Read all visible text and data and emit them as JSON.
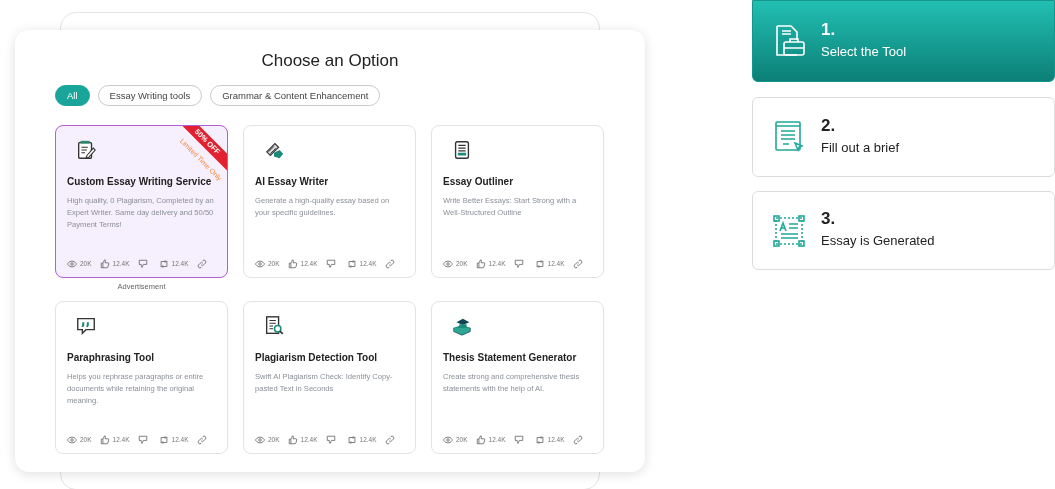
{
  "panel": {
    "title": "Choose an Option"
  },
  "filters": [
    {
      "label": "All",
      "selected": true
    },
    {
      "label": "Essay Writing tools",
      "selected": false
    },
    {
      "label": "Grammar & Content Enhancement",
      "selected": false
    }
  ],
  "tools": [
    {
      "title": "Custom Essay Writing Service",
      "description": "High quality, 0 Plagiarism, Completed by an Expert Writer. Same day delivery and 50/50 Payment Terms!",
      "featured": true,
      "ribbon": "50% OFF",
      "ribbon_note": "Limited Time Only",
      "caption": "Advertisement",
      "views": "20K",
      "likes": "12.4K",
      "shares": "12.4K"
    },
    {
      "title": "AI Essay Writer",
      "description": "Generate a high-quality essay based on your specific guidelines.",
      "featured": false,
      "views": "20K",
      "likes": "12.4K",
      "shares": "12.4K"
    },
    {
      "title": "Essay Outliner",
      "description": "Write Better Essays: Start Strong with a Well-Structured Outline",
      "featured": false,
      "views": "20K",
      "likes": "12.4K",
      "shares": "12.4K"
    },
    {
      "title": "Paraphrasing Tool",
      "description": "Helps you rephrase paragraphs or entire documents while retaining the original meaning.",
      "featured": false,
      "views": "20K",
      "likes": "12.4K",
      "shares": "12.4K"
    },
    {
      "title": "Plagiarism Detection Tool",
      "description": "Swift AI Plagiarism Check: Identify Copy-pasted Text in Seconds",
      "featured": false,
      "views": "20K",
      "likes": "12.4K",
      "shares": "12.4K"
    },
    {
      "title": "Thesis Statement Generator",
      "description": "Create strong and comprehensive thesis statements with the help of AI.",
      "featured": false,
      "views": "20K",
      "likes": "12.4K",
      "shares": "12.4K"
    }
  ],
  "steps": [
    {
      "number": "1.",
      "label": "Select the Tool",
      "active": true
    },
    {
      "number": "2.",
      "label": "Fill out a brief",
      "active": false
    },
    {
      "number": "3.",
      "label": "Essay is Generated",
      "active": false
    }
  ]
}
